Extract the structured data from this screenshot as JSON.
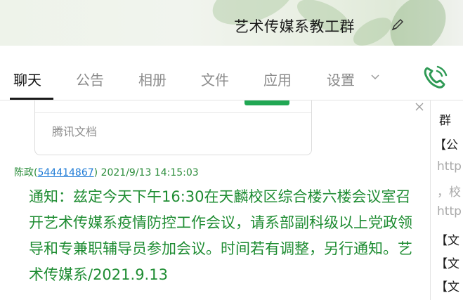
{
  "header": {
    "title": "艺术传媒系教工群",
    "edit_icon": "pencil-icon"
  },
  "tabs": [
    {
      "label": "聊天",
      "active": true
    },
    {
      "label": "公告",
      "active": false
    },
    {
      "label": "相册",
      "active": false
    },
    {
      "label": "文件",
      "active": false
    },
    {
      "label": "应用",
      "active": false
    },
    {
      "label": "设置",
      "active": false
    }
  ],
  "call_icon": "phone-icon",
  "doc_card": {
    "label": "腾讯文档"
  },
  "message": {
    "sender_name": "陈政",
    "sender_qq_open": "(",
    "sender_qq": "544414867",
    "sender_qq_close": ")",
    "timestamp": "2021/9/13 14:15:03",
    "text": "通知：兹定今天下午16:30在天麟校区综合楼六楼会议室召开艺术传媒系疫情防控工作会议，请系部副科级以上党政领导和专兼职辅导员参加会议。时间若有调整，另行通知。艺术传媒系/2021.9.13"
  },
  "side_panel": {
    "rows": [
      "群",
      "【公",
      "http",
      "，校",
      "http",
      "【文",
      "【文",
      "【文"
    ]
  },
  "colors": {
    "accent_green": "#21a753",
    "message_green": "#1e8c32",
    "link_blue": "#1f7bd6"
  }
}
